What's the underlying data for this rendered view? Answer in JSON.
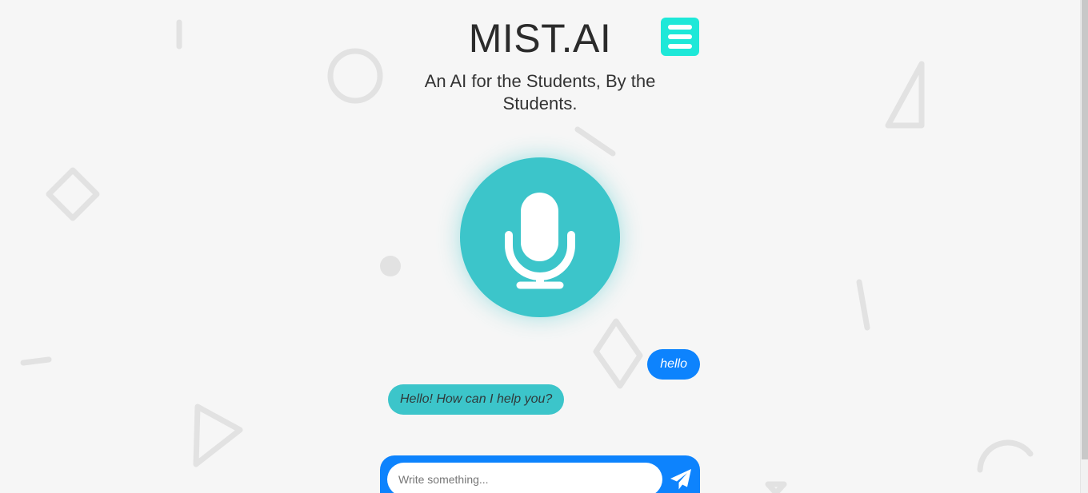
{
  "app": {
    "title": "MIST.AI",
    "subtitle": "An AI for the Students, By the Students."
  },
  "header": {
    "menu_icon": "hamburger-menu-icon"
  },
  "voice": {
    "icon": "microphone-icon"
  },
  "chat": {
    "messages": [
      {
        "role": "user",
        "text": "hello"
      },
      {
        "role": "bot",
        "text": "Hello! How can I help you?"
      }
    ]
  },
  "composer": {
    "placeholder": "Write something...",
    "value": "",
    "send_icon": "paper-plane-icon"
  },
  "colors": {
    "accent_teal": "#3cc5ca",
    "menu_cyan": "#1ee8d8",
    "user_blue": "#0d83fd",
    "background": "#f6f6f6"
  }
}
